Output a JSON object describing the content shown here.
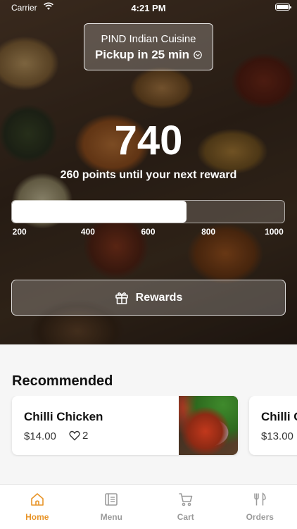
{
  "status_bar": {
    "carrier": "Carrier",
    "time": "4:21 PM"
  },
  "store": {
    "name": "PIND Indian Cuisine",
    "pickup": "Pickup in 25 min"
  },
  "loyalty": {
    "points": "740",
    "subtitle": "260 points until your next reward",
    "progress_fraction": 0.64,
    "ticks": [
      "200",
      "400",
      "600",
      "800",
      "1000"
    ],
    "rewards_label": "Rewards"
  },
  "recommended": {
    "title": "Recommended",
    "items": [
      {
        "name": "Chilli Chicken",
        "price": "$14.00",
        "likes": "2"
      },
      {
        "name": "Chilli C",
        "price": "$13.00"
      }
    ]
  },
  "tabs": [
    {
      "label": "Home",
      "icon": "home-icon",
      "active": true
    },
    {
      "label": "Menu",
      "icon": "menu-icon",
      "active": false
    },
    {
      "label": "Cart",
      "icon": "cart-icon",
      "active": false
    },
    {
      "label": "Orders",
      "icon": "orders-icon",
      "active": false
    }
  ],
  "colors": {
    "accent": "#e8952a",
    "tab_inactive": "#9b9b9b"
  }
}
